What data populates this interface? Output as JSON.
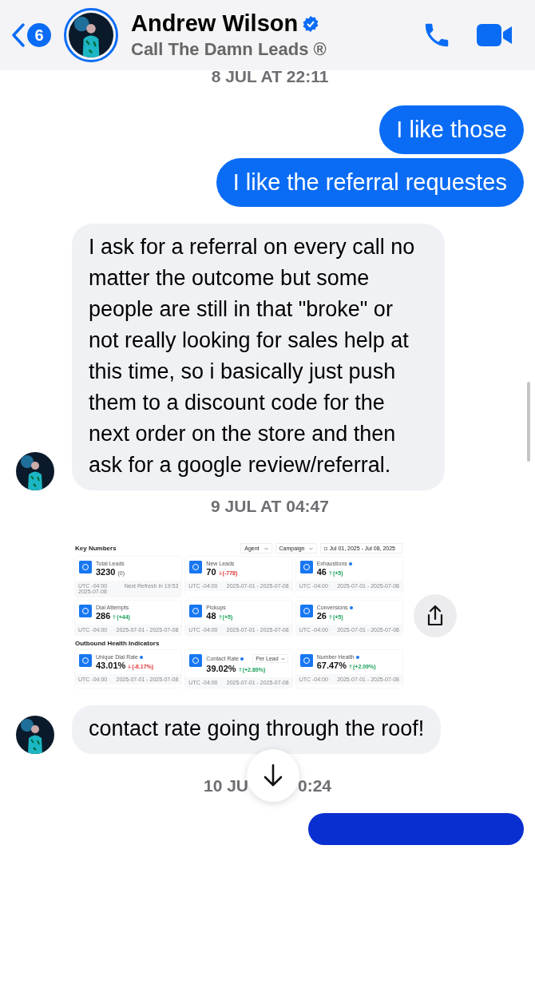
{
  "header": {
    "back_count": "6",
    "name": "Andrew Wilson",
    "verified": true,
    "subtitle": "Call The Damn Leads ®"
  },
  "messages": [
    {
      "kind": "timestamp",
      "text": "8 JUL AT 22:11"
    },
    {
      "kind": "sent",
      "text": "I like those"
    },
    {
      "kind": "sent",
      "text": "I like the referral requestes"
    },
    {
      "kind": "received",
      "avatar": true,
      "text": "I ask for a referral on every call no matter the outcome but some people are still in that \"broke\" or not really looking for sales help at this time, so i basically just push them to a discount code for the next order on the store and then ask for a google review/referral."
    },
    {
      "kind": "timestamp",
      "text": "9 JUL AT 04:47"
    },
    {
      "kind": "dashboard"
    },
    {
      "kind": "received",
      "avatar": true,
      "text": "contact rate going through the roof!"
    },
    {
      "kind": "covered_timestamp",
      "left": "10 JU",
      "right": "0:24"
    },
    {
      "kind": "sent_cut"
    }
  ],
  "dashboard": {
    "title": "Key Numbers",
    "filters": [
      "Agent",
      "Campaign"
    ],
    "date_range": "Jul 01, 2025 - Jul 08, 2025",
    "sections": [
      {
        "cards": [
          {
            "label": "Total Leads",
            "value": "3230",
            "change": "(0)",
            "kind": "flat",
            "info": false,
            "footer": [
              "UTC -04:00",
              "Next Refresh in 19:53",
              "2025-07-08"
            ]
          },
          {
            "label": "New Leads",
            "value": "70",
            "change": "(-778)",
            "kind": "down",
            "info": false,
            "footer": [
              "UTC -04:00",
              "2025-07-01 - 2025-07-08"
            ]
          },
          {
            "label": "Exhaustions",
            "value": "46",
            "change": "(+5)",
            "kind": "up",
            "info": true,
            "footer": [
              "UTC -04:00",
              "2025-07-01 - 2025-07-08"
            ]
          },
          {
            "label": "Dial Attempts",
            "value": "286",
            "change": "(+44)",
            "kind": "up",
            "info": false,
            "footer": [
              "UTC -04:00",
              "2025-07-01 - 2025-07-08"
            ]
          },
          {
            "label": "Pickups",
            "value": "48",
            "change": "(+5)",
            "kind": "up",
            "info": false,
            "footer": [
              "UTC -04:00",
              "2025-07-01 - 2025-07-08"
            ]
          },
          {
            "label": "Conversions",
            "value": "26",
            "change": "(+5)",
            "kind": "up",
            "info": true,
            "footer": [
              "UTC -04:00",
              "2025-07-01 - 2025-07-08"
            ]
          }
        ]
      },
      {
        "title": "Outbound Health Indicators",
        "cards": [
          {
            "label": "Unique Dial Rate",
            "value": "43.01%",
            "change": "(-6.17%)",
            "kind": "down",
            "info": true,
            "footer": [
              "UTC -04:00",
              "2025-07-01 - 2025-07-08"
            ]
          },
          {
            "label": "Contact Rate",
            "value": "39.02%",
            "change": "(+2.89%)",
            "kind": "up",
            "info": true,
            "dropdown": "Per Lead",
            "footer": [
              "UTC -04:00",
              "2025-07-01 - 2025-07-08"
            ]
          },
          {
            "label": "Number Health",
            "value": "67.47%",
            "change": "(+2.09%)",
            "kind": "up",
            "info": true,
            "footer": [
              "UTC -04:00",
              "2025-07-01 - 2025-07-08"
            ]
          }
        ]
      }
    ]
  }
}
